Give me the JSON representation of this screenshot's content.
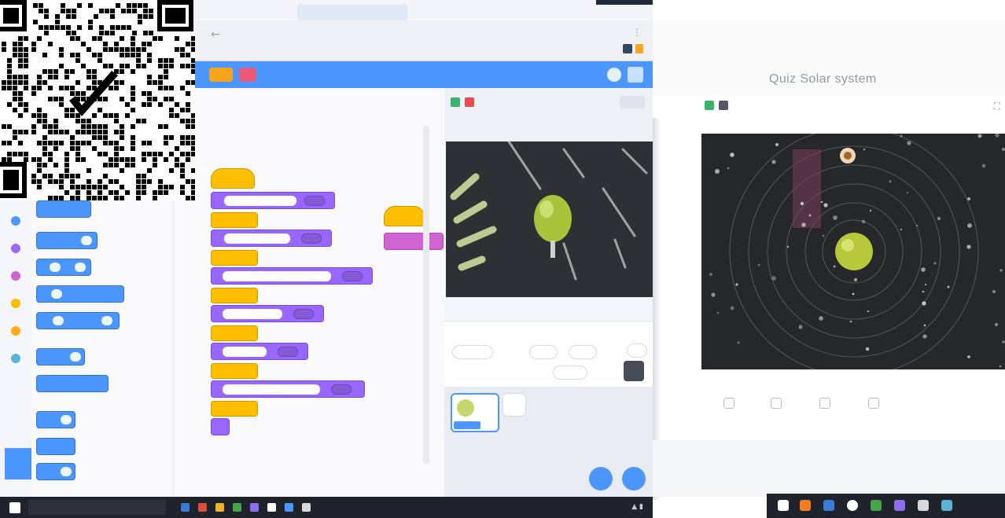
{
  "left_window": {
    "browser": {
      "back_icon": "back-arrow-icon",
      "menu_icon": "more-dots-icon"
    },
    "editor": {
      "project_title": "",
      "accent_color": "#4c97ff",
      "looks_color": "#9966ff",
      "events_color": "#ffbf00"
    },
    "taskbar": {
      "search_placeholder": ""
    }
  },
  "right_window": {
    "brand": "",
    "title": "Quiz Solar system",
    "footer_label": ""
  }
}
